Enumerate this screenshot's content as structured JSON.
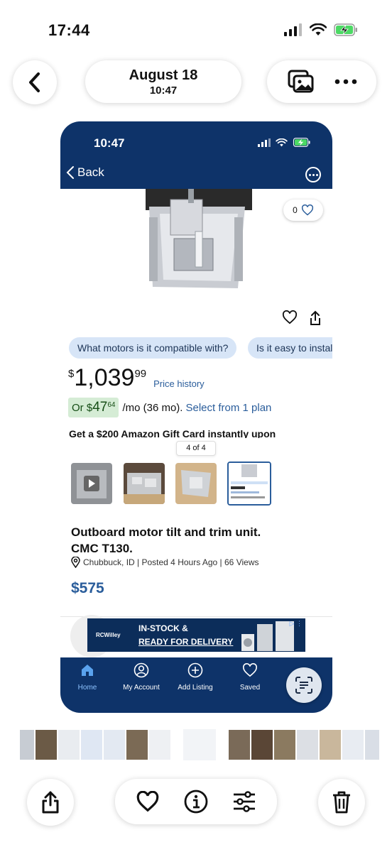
{
  "status_bar": {
    "time": "17:44"
  },
  "header": {
    "date": "August 18",
    "time": "10:47"
  },
  "screenshot": {
    "status_time": "10:47",
    "back_label": "Back",
    "like_count": "0",
    "chips": [
      "What motors is it compatible with?",
      "Is it easy to install"
    ],
    "price": {
      "currency": "$",
      "whole": "1,039",
      "cents": "99",
      "history_label": "Price history"
    },
    "monthly": {
      "prefix": "Or $",
      "whole": "47",
      "cents": "64",
      "suffix": "/mo (36 mo).",
      "link": "Select from 1 plan"
    },
    "gift_text": "Get a $200 Amazon Gift Card instantly upon",
    "image_counter": "4 of 4",
    "listing": {
      "title_line1": "Outboard motor tilt and trim unit.",
      "title_line2": "CMC T130.",
      "location": "Chubbuck, ID | Posted 4 Hours Ago | 66 Views",
      "price": "$575"
    },
    "ad": {
      "brand": "RCWilley",
      "line1": "IN-STOCK &",
      "line2": "READY FOR DELIVERY"
    },
    "tabs": [
      "Home",
      "My Account",
      "Add Listing",
      "Saved"
    ]
  },
  "colors": {
    "navy": "#0e3369",
    "link_blue": "#2a5d9b",
    "chip_bg": "#d7e5f7"
  }
}
